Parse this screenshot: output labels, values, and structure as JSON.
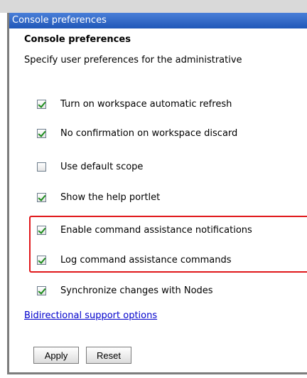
{
  "window": {
    "title": "Console preferences"
  },
  "section": {
    "heading": "Console preferences",
    "description": "Specify user preferences for the administrative"
  },
  "options": [
    {
      "label": "Turn on workspace automatic refresh",
      "checked": true
    },
    {
      "label": "No confirmation on workspace discard",
      "checked": true
    },
    {
      "label": "Use default scope",
      "checked": false
    },
    {
      "label": "Show the help portlet",
      "checked": true
    },
    {
      "label": "Enable command assistance notifications",
      "checked": true
    },
    {
      "label": "Log command assistance commands",
      "checked": true
    },
    {
      "label": "Synchronize changes with Nodes",
      "checked": true
    }
  ],
  "link": {
    "label": "Bidirectional support options"
  },
  "buttons": {
    "apply": "Apply",
    "reset": "Reset"
  },
  "colors": {
    "title_bar": "#2b63c6",
    "highlight": "#e0181b",
    "link": "#0000cc",
    "check": "#1c8c1c"
  }
}
